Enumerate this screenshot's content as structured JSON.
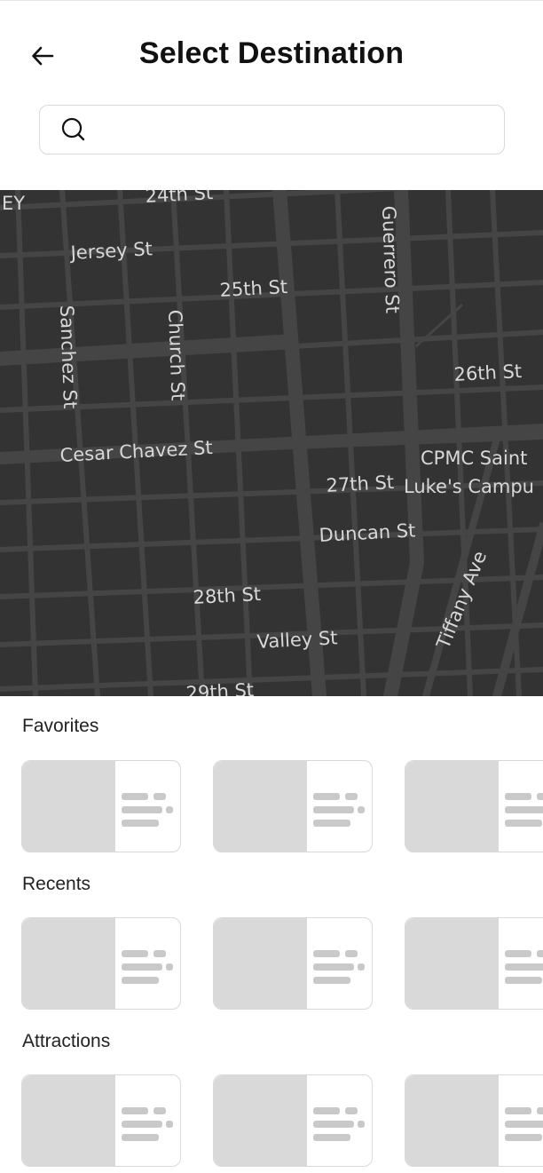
{
  "header": {
    "title": "Select Destination",
    "back_icon": "arrow-left-icon"
  },
  "search": {
    "placeholder": "",
    "value": "",
    "icon": "search-icon"
  },
  "map": {
    "theme": "dark",
    "background": "#333333",
    "labels": {
      "area": "EY",
      "street_24th": "24th St",
      "jersey": "Jersey St",
      "street_25th": "25th St",
      "sanchez": "Sanchez St",
      "church": "Church St",
      "guerrero": "Guerrero St",
      "street_26th": "26th St",
      "cesar_chavez": "Cesar Chavez St",
      "street_27th": "27th St",
      "cpmc_line1": "CPMC Saint",
      "cpmc_line2": "Luke's Campu",
      "duncan": "Duncan St",
      "tiffany": "Tiffany Ave",
      "street_28th": "28th St",
      "valley": "Valley St",
      "street_29th": "29th St"
    }
  },
  "sections": {
    "favorites": {
      "label": "Favorites"
    },
    "recents": {
      "label": "Recents"
    },
    "attractions": {
      "label": "Attractions"
    }
  },
  "colors": {
    "placeholder_fill": "#d9d9d9",
    "card_border": "#d9d9d9",
    "map_street": "#444444"
  }
}
